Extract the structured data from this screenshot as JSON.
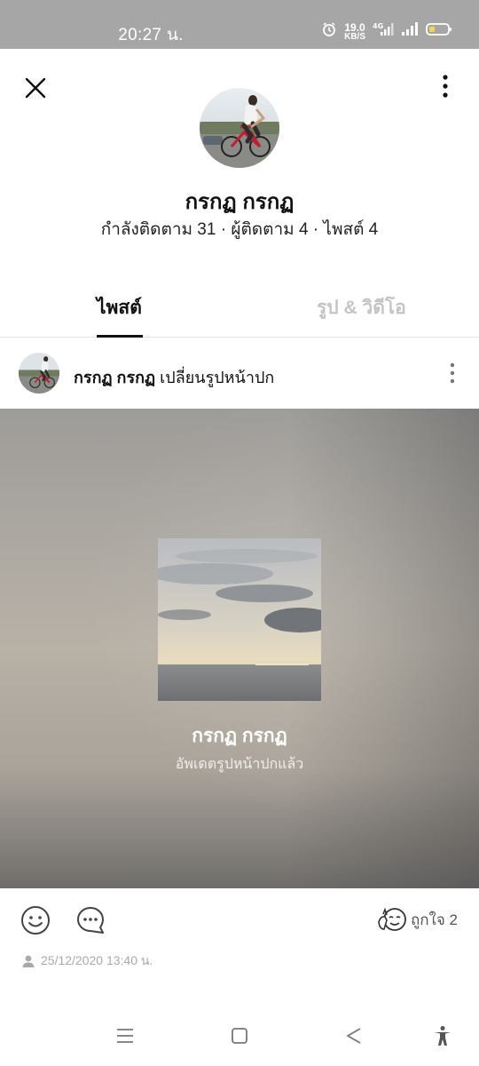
{
  "status_bar": {
    "time": "20:27 น.",
    "net_speed": "19.0",
    "net_unit": "KB/S",
    "network_type": "4G",
    "icons": [
      "alarm-icon",
      "signal-icon",
      "battery-icon"
    ]
  },
  "profile": {
    "name": "กรกฏ กรกฏ",
    "stats": "กำลังติดตาม 31 · ผู้ติดตาม 4 · ไพสต์ 4"
  },
  "tabs": [
    {
      "label": "ไพสต์",
      "active": true
    },
    {
      "label": "รูป & วิดีโอ",
      "active": false
    }
  ],
  "post": {
    "author": "กรกฏ กรกฏ",
    "action": "เปลี่ยนรูปหน้าปก",
    "cover_name": "กรกฏ กรกฏ",
    "cover_caption": "อัพเดตรูปหน้าปกแล้ว",
    "like_label": "ถูกใจ 2",
    "timestamp": "25/12/2020 13:40 น."
  },
  "colors": {
    "status_bar_bg": "#a6a6a6",
    "active_tab": "#111111",
    "inactive_tab": "#c4c4c4",
    "meta_text": "#aaaaaa"
  }
}
